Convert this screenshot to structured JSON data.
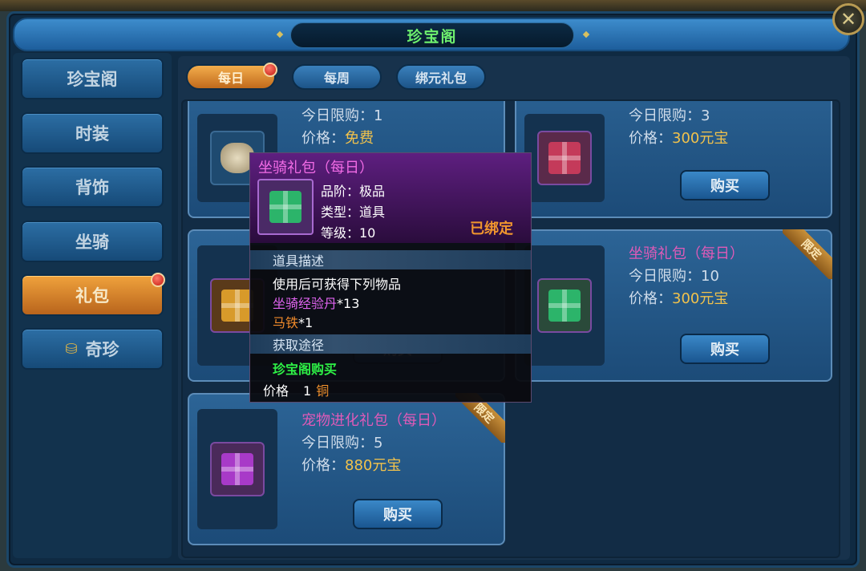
{
  "window": {
    "title": "珍宝阁",
    "close_symbol": "✕"
  },
  "sidebar": {
    "items": [
      {
        "label": "珍宝阁",
        "active": false
      },
      {
        "label": "时装",
        "active": false
      },
      {
        "label": "背饰",
        "active": false
      },
      {
        "label": "坐骑",
        "active": false
      },
      {
        "label": "礼包",
        "active": true,
        "has_dot": true
      },
      {
        "label": "奇珍",
        "active": false,
        "icon": "coin-stack-icon"
      }
    ]
  },
  "tabs": [
    {
      "label": "每日",
      "active": true,
      "has_dot": true
    },
    {
      "label": "每周",
      "active": false
    },
    {
      "label": "绑元礼包",
      "active": false
    }
  ],
  "cards": [
    {
      "name": "",
      "limit": "今日限购：1",
      "price_label": "价格：",
      "price": "免费",
      "buy_label": "",
      "icon": "sack-icon",
      "ribbon": ""
    },
    {
      "name": "",
      "limit": "今日限购：3",
      "price_label": "价格：",
      "price": "300元宝",
      "buy_label": "购买",
      "icon": "red-gift-icon",
      "ribbon": ""
    },
    {
      "name": "",
      "limit": "",
      "price_label": "",
      "price": "",
      "buy_label": "购买",
      "icon": "gold-gift-icon",
      "ribbon": ""
    },
    {
      "name": "坐骑礼包（每日）",
      "limit": "今日限购：10",
      "price_label": "价格：",
      "price": "300元宝",
      "buy_label": "购买",
      "icon": "green-gift-icon",
      "ribbon": "限定"
    },
    {
      "name": "宠物进化礼包（每日）",
      "limit": "今日限购：5",
      "price_label": "价格：",
      "price": "880元宝",
      "buy_label": "购买",
      "icon": "purple-gift-icon",
      "ribbon": "限定"
    }
  ],
  "tooltip": {
    "title": "坐骑礼包（每日）",
    "quality": "品阶：极品",
    "type": "类型：道具",
    "level": "等级：10",
    "bound": "已绑定",
    "desc_header": "道具描述",
    "desc_line": "使用后可获得下列物品",
    "reward1_name": "坐骑经验丹",
    "reward1_qty": "*13",
    "reward2_name": "马铁",
    "reward2_qty": "*1",
    "source_header": "获取途径",
    "source": "珍宝阁购买",
    "price_label": "价格",
    "price_value": "1",
    "price_unit": "铜"
  },
  "colors": {
    "active_orange": "#f0a23c",
    "button_blue": "#2c6ea4",
    "title_green": "#6ef06e",
    "name_pink": "#e05ab8",
    "price_gold": "#f1c24c"
  }
}
